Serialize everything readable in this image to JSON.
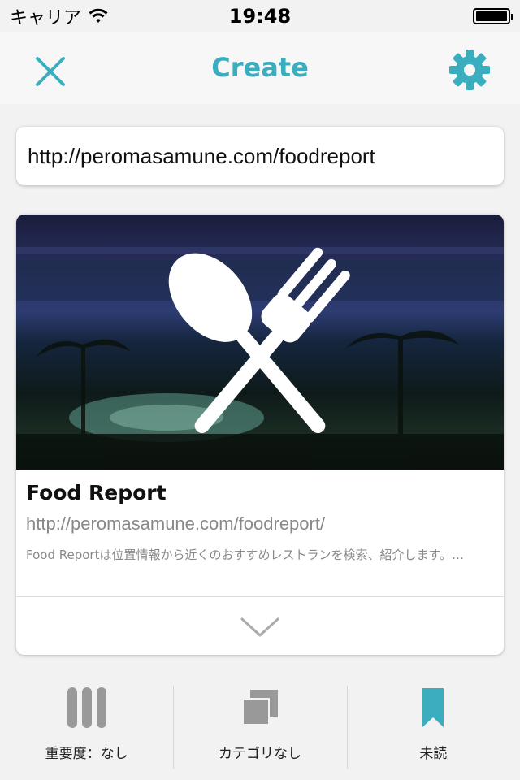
{
  "status_bar": {
    "carrier": "キャリア",
    "time": "19:48"
  },
  "nav": {
    "title": "Create"
  },
  "url_field": {
    "value": "http://peromasamune.com/foodreport"
  },
  "card": {
    "title": "Food Report",
    "url": "http://peromasamune.com/foodreport/",
    "description": "Food Reportは位置情報から近くのおすすめレストランを検索、紹介します。…"
  },
  "bottom": {
    "importance_label": "重要度：なし",
    "category_label": "カテゴリなし",
    "unread_label": "未読"
  },
  "colors": {
    "accent": "#3aaebf",
    "icon_gray": "#999999",
    "background": "#f2f2f2"
  }
}
